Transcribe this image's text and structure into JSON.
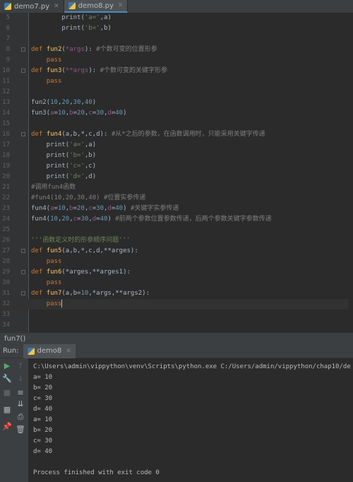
{
  "tabs": [
    {
      "label": "demo7.py",
      "active": false
    },
    {
      "label": "demo8.py",
      "active": true
    }
  ],
  "editor": {
    "lines": [
      {
        "n": "5",
        "segs": [
          [
            "",
            "        "
          ],
          [
            "",
            "print("
          ],
          [
            "str",
            "'a='"
          ],
          [
            "",
            ","
          ],
          [
            "",
            "a)"
          ]
        ]
      },
      {
        "n": "6",
        "segs": [
          [
            "",
            "        "
          ],
          [
            "",
            "print("
          ],
          [
            "str",
            "'b='"
          ],
          [
            "",
            ","
          ],
          [
            "",
            "b)"
          ]
        ]
      },
      {
        "n": "7",
        "segs": []
      },
      {
        "n": "8",
        "segs": [
          [
            "kw",
            "def "
          ],
          [
            "fn",
            "fun2"
          ],
          [
            "",
            "("
          ],
          [
            "par",
            "*args"
          ],
          [
            "",
            "): "
          ],
          [
            "cm",
            "#个数可变的位置形参"
          ]
        ]
      },
      {
        "n": "9",
        "segs": [
          [
            "",
            "    "
          ],
          [
            "kw",
            "pass"
          ]
        ]
      },
      {
        "n": "10",
        "segs": [
          [
            "kw",
            "def "
          ],
          [
            "fn",
            "fun3"
          ],
          [
            "",
            "("
          ],
          [
            "par",
            "**args"
          ],
          [
            "",
            "): "
          ],
          [
            "cm",
            "#个数可变的关键字形参"
          ]
        ]
      },
      {
        "n": "11",
        "segs": [
          [
            "",
            "    "
          ],
          [
            "kw",
            "pass"
          ]
        ]
      },
      {
        "n": "12",
        "segs": []
      },
      {
        "n": "13",
        "segs": [
          [
            "",
            "fun2("
          ],
          [
            "num",
            "10"
          ],
          [
            "",
            ","
          ],
          [
            "num",
            "20"
          ],
          [
            "",
            ","
          ],
          [
            "num",
            "30"
          ],
          [
            "",
            ","
          ],
          [
            "num",
            "40"
          ],
          [
            "",
            ")"
          ]
        ]
      },
      {
        "n": "14",
        "segs": [
          [
            "",
            "fun3("
          ],
          [
            "par",
            "a"
          ],
          [
            "",
            "="
          ],
          [
            "num",
            "10"
          ],
          [
            "",
            ","
          ],
          [
            "par",
            "b"
          ],
          [
            "",
            "="
          ],
          [
            "num",
            "20"
          ],
          [
            "",
            ","
          ],
          [
            "par",
            "c"
          ],
          [
            "",
            "="
          ],
          [
            "num",
            "30"
          ],
          [
            "",
            ","
          ],
          [
            "par",
            "d"
          ],
          [
            "",
            "="
          ],
          [
            "num",
            "40"
          ],
          [
            "",
            ")"
          ]
        ]
      },
      {
        "n": "15",
        "segs": []
      },
      {
        "n": "16",
        "segs": [
          [
            "kw",
            "def "
          ],
          [
            "fn",
            "fun4"
          ],
          [
            "",
            "(a,b,*,c,d): "
          ],
          [
            "cm",
            "#从*之后的参数，在函数调用时，只能采用关键字传递"
          ]
        ]
      },
      {
        "n": "17",
        "segs": [
          [
            "",
            "    print("
          ],
          [
            "str",
            "'a='"
          ],
          [
            "",
            ",a)"
          ]
        ]
      },
      {
        "n": "18",
        "segs": [
          [
            "",
            "    print("
          ],
          [
            "str",
            "'b='"
          ],
          [
            "",
            ",b)"
          ]
        ]
      },
      {
        "n": "19",
        "segs": [
          [
            "",
            "    print("
          ],
          [
            "str",
            "'c='"
          ],
          [
            "",
            ",c)"
          ]
        ]
      },
      {
        "n": "20",
        "segs": [
          [
            "",
            "    print("
          ],
          [
            "str",
            "'d='"
          ],
          [
            "",
            ",d)"
          ]
        ]
      },
      {
        "n": "21",
        "segs": [
          [
            "cm",
            "#调用fun4函数"
          ]
        ]
      },
      {
        "n": "22",
        "segs": [
          [
            "cm",
            "#fun4(10,20,30,40) #位置实参传递"
          ]
        ]
      },
      {
        "n": "23",
        "segs": [
          [
            "",
            "fun4("
          ],
          [
            "par",
            "a"
          ],
          [
            "",
            "="
          ],
          [
            "num",
            "10"
          ],
          [
            "",
            ","
          ],
          [
            "par",
            "b"
          ],
          [
            "",
            "="
          ],
          [
            "num",
            "20"
          ],
          [
            "",
            ","
          ],
          [
            "par",
            "c"
          ],
          [
            "",
            "="
          ],
          [
            "num",
            "30"
          ],
          [
            "",
            ","
          ],
          [
            "par",
            "d"
          ],
          [
            "",
            "="
          ],
          [
            "num",
            "40"
          ],
          [
            "",
            ") "
          ],
          [
            "cm",
            "#关键字实参传递"
          ]
        ]
      },
      {
        "n": "24",
        "segs": [
          [
            "",
            "fun4("
          ],
          [
            "num",
            "10"
          ],
          [
            "",
            ","
          ],
          [
            "num",
            "20"
          ],
          [
            "",
            ","
          ],
          [
            "par",
            "c"
          ],
          [
            "",
            "="
          ],
          [
            "num",
            "30"
          ],
          [
            "",
            ","
          ],
          [
            "par",
            "d"
          ],
          [
            "",
            "="
          ],
          [
            "num",
            "40"
          ],
          [
            "",
            ") "
          ],
          [
            "cm",
            "#前两个参数位置参数传递，后两个参数关键字参数传递"
          ]
        ]
      },
      {
        "n": "25",
        "segs": []
      },
      {
        "n": "26",
        "segs": [
          [
            "str",
            "'''函数定义时的形参顺序问题'''"
          ]
        ]
      },
      {
        "n": "27",
        "segs": [
          [
            "kw",
            "def "
          ],
          [
            "fn",
            "fun5"
          ],
          [
            "",
            "(a,b,*,c,d,**arges):"
          ]
        ]
      },
      {
        "n": "28",
        "segs": [
          [
            "",
            "    "
          ],
          [
            "kw",
            "pass"
          ]
        ]
      },
      {
        "n": "29",
        "segs": [
          [
            "kw",
            "def "
          ],
          [
            "fn",
            "fun6"
          ],
          [
            "",
            "(*arges,**arges1):"
          ]
        ]
      },
      {
        "n": "30",
        "segs": [
          [
            "",
            "    "
          ],
          [
            "kw",
            "pass"
          ]
        ]
      },
      {
        "n": "31",
        "segs": [
          [
            "kw",
            "def "
          ],
          [
            "fn",
            "fun7"
          ],
          [
            "",
            "(a,b="
          ],
          [
            "num",
            "10"
          ],
          [
            "",
            ",*args,**args2):"
          ]
        ]
      },
      {
        "n": "32",
        "segs": [
          [
            "",
            "    "
          ],
          [
            "kw",
            "pass"
          ]
        ],
        "current": true
      },
      {
        "n": "33",
        "segs": []
      },
      {
        "n": "34",
        "segs": []
      }
    ]
  },
  "breadcrumb": "fun7()",
  "run": {
    "label": "Run:",
    "config": "demo8",
    "console": [
      "C:\\Users\\admin\\vippython\\venv\\Scripts\\python.exe C:/Users/admin/vippython/chap10/de",
      "a= 10",
      "b= 20",
      "c= 30",
      "d= 40",
      "a= 10",
      "b= 20",
      "c= 30",
      "d= 40",
      "",
      "Process finished with exit code 0"
    ]
  },
  "tools": [
    {
      "name": "rerun-icon",
      "glyph": "▶",
      "color": "#59a869"
    },
    {
      "name": "up-arrow-icon",
      "glyph": "↑",
      "color": "#5a5d5f"
    },
    {
      "name": "wrench-icon",
      "glyph": "🔧",
      "color": "#afb1b3"
    },
    {
      "name": "down-arrow-icon",
      "glyph": "↓",
      "color": "#5a5d5f"
    },
    {
      "name": "stop-icon",
      "glyph": "■",
      "color": "#5a5d5f"
    },
    {
      "name": "soft-wrap-icon",
      "glyph": "≡",
      "color": "#afb1b3"
    },
    {
      "name": "scroll-end-icon",
      "glyph": "⇊",
      "color": "#afb1b3"
    },
    {
      "name": "layout-icon",
      "glyph": "▦",
      "color": "#afb1b3"
    },
    {
      "name": "print-icon",
      "glyph": "⎙",
      "color": "#afb1b3"
    },
    {
      "name": "pin-icon",
      "glyph": "📌",
      "color": "#afb1b3"
    },
    {
      "name": "trash-icon",
      "glyph": "🗑",
      "color": "#afb1b3"
    }
  ]
}
